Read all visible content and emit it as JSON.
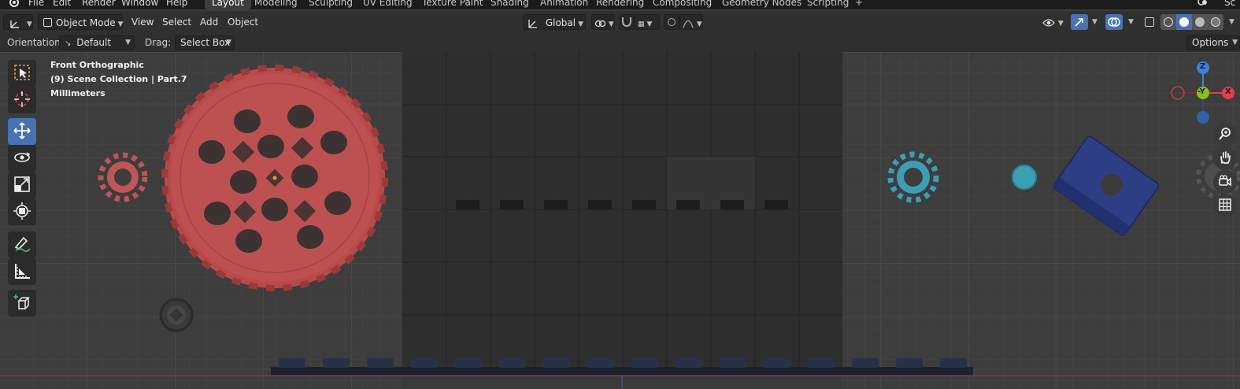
{
  "menu": {
    "items": [
      "File",
      "Edit",
      "Render",
      "Window",
      "Help"
    ],
    "logo": "blender-logo-icon"
  },
  "workspaces": {
    "tabs": [
      "Layout",
      "Modeling",
      "Sculpting",
      "UV Editing",
      "Texture Paint",
      "Shading",
      "Animation",
      "Rendering",
      "Compositing",
      "Geometry Nodes",
      "Scripting"
    ],
    "active": "Layout",
    "add_label": "+",
    "scene_fragment": "Sc"
  },
  "header": {
    "mode": "Object Mode",
    "view": "View",
    "select": "Select",
    "add": "Add",
    "object": "Object",
    "transform_orientation": "Global"
  },
  "tool_settings": {
    "orientation_label": "Orientation:",
    "orientation_value": "Default",
    "drag_label": "Drag:",
    "drag_value": "Select Box",
    "options": "Options"
  },
  "viewport": {
    "view_name": "Front Orthographic",
    "collection": "(9) Scene Collection | Part.7",
    "units": "Millimeters",
    "gizmo": {
      "z": "Z",
      "y": "-Y",
      "x": "X"
    }
  },
  "colors": {
    "accent": "#4772b3",
    "gear_red": "#b84a4a",
    "teal": "#3a9fb4",
    "navy": "#2e3e85",
    "axis_x": "#e04050",
    "axis_y": "#88c020",
    "axis_z": "#4080d8"
  },
  "tools": [
    "select-box-icon",
    "cursor-icon",
    "move-icon",
    "rotate-icon",
    "scale-icon",
    "transform-icon",
    "annotate-icon",
    "measure-icon",
    "add-cube-icon"
  ]
}
